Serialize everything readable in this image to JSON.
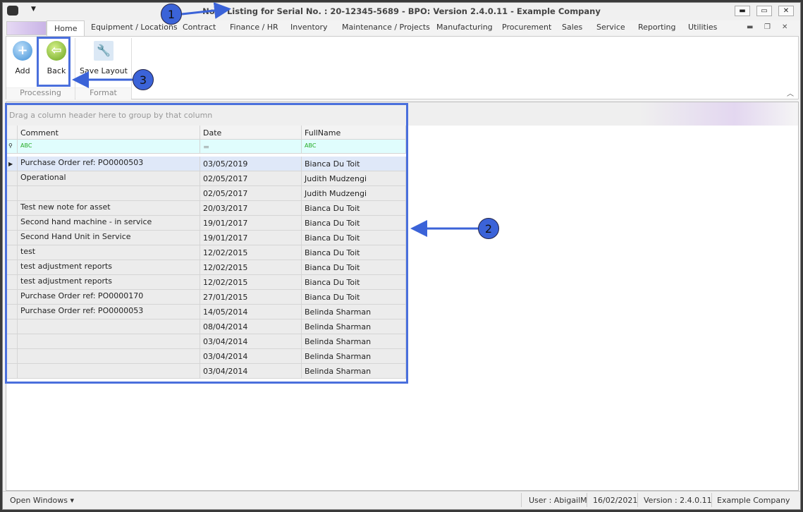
{
  "window": {
    "title": "Note Listing for Serial No. : 20-12345-5689 - BPO: Version 2.4.0.11 - Example Company",
    "minimize": "▬",
    "maximize": "▭",
    "close": "✕"
  },
  "tabs": [
    "Home",
    "Equipment / Locations",
    "Contract",
    "Finance / HR",
    "Inventory",
    "Maintenance / Projects",
    "Manufacturing",
    "Procurement",
    "Sales",
    "Service",
    "Reporting",
    "Utilities"
  ],
  "ribbon": {
    "add": "Add",
    "back": "Back",
    "save_layout": "Save Layout",
    "group_processing": "Processing",
    "group_format": "Format"
  },
  "grid": {
    "group_hint": "Drag a column header here to group by that column",
    "columns": [
      "Comment",
      "Date",
      "FullName"
    ],
    "rows": [
      [
        "Purchase Order ref: PO0000503",
        "03/05/2019",
        "Bianca Du Toit"
      ],
      [
        "Operational",
        "02/05/2017",
        "Judith Mudzengi"
      ],
      [
        "",
        "02/05/2017",
        "Judith Mudzengi"
      ],
      [
        "Test new note for asset",
        "20/03/2017",
        "Bianca Du Toit"
      ],
      [
        "Second hand machine - in service",
        "19/01/2017",
        "Bianca Du Toit"
      ],
      [
        "Second Hand Unit in Service",
        "19/01/2017",
        "Bianca Du Toit"
      ],
      [
        "test",
        "12/02/2015",
        "Bianca Du Toit"
      ],
      [
        "test adjustment reports",
        "12/02/2015",
        "Bianca Du Toit"
      ],
      [
        "test adjustment reports",
        "12/02/2015",
        "Bianca Du Toit"
      ],
      [
        "Purchase Order ref: PO0000170",
        "27/01/2015",
        "Bianca Du Toit"
      ],
      [
        "Purchase Order ref: PO0000053",
        "14/05/2014",
        "Belinda Sharman"
      ],
      [
        "",
        "08/04/2014",
        "Belinda Sharman"
      ],
      [
        "",
        "03/04/2014",
        "Belinda Sharman"
      ],
      [
        "",
        "03/04/2014",
        "Belinda Sharman"
      ],
      [
        "",
        "03/04/2014",
        "Belinda Sharman"
      ]
    ]
  },
  "status": {
    "open_windows": "Open Windows ▾",
    "user": "User : AbigailM",
    "date": "16/02/2021",
    "version": "Version : 2.4.0.11",
    "company": "Example Company"
  },
  "annotations": [
    "1",
    "2",
    "3"
  ]
}
